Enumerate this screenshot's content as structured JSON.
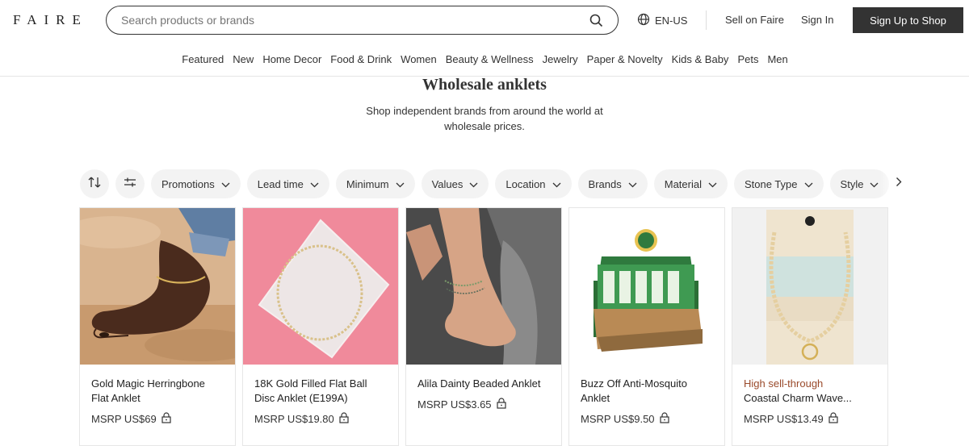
{
  "header": {
    "logo": "FAIRE",
    "search_placeholder": "Search products or brands",
    "locale": "EN-US",
    "sell_link": "Sell on Faire",
    "signin_link": "Sign In",
    "signup_button": "Sign Up to Shop"
  },
  "categories": [
    "Featured",
    "New",
    "Home Decor",
    "Food & Drink",
    "Women",
    "Beauty & Wellness",
    "Jewelry",
    "Paper & Novelty",
    "Kids & Baby",
    "Pets",
    "Men"
  ],
  "page": {
    "title": "Wholesale anklets",
    "subtitle": "Shop independent brands from around the world at wholesale prices."
  },
  "filters": [
    "Promotions",
    "Lead time",
    "Minimum",
    "Values",
    "Location",
    "Brands",
    "Material",
    "Stone Type",
    "Style"
  ],
  "products": [
    {
      "tag": "",
      "name": "Gold Magic Herringbone Flat Anklet",
      "price": "MSRP US$69"
    },
    {
      "tag": "",
      "name": "18K Gold Filled Flat Ball Disc Anklet (E199A)",
      "price": "MSRP US$19.80"
    },
    {
      "tag": "",
      "name": "Alila Dainty Beaded Anklet",
      "price": "MSRP US$3.65"
    },
    {
      "tag": "",
      "name": "Buzz Off Anti-Mosquito Anklet",
      "price": "MSRP US$9.50"
    },
    {
      "tag": "High sell-through",
      "name": "Coastal Charm Wave...",
      "price": "MSRP US$13.49"
    }
  ],
  "icons": {
    "search": "search-icon",
    "globe": "globe-icon",
    "sort": "sort-icon",
    "filter": "filter-sliders-icon",
    "chevron": "chevron-down-icon",
    "next": "chevron-right-icon",
    "lock": "lock-icon"
  },
  "colors": {
    "signup_bg": "#333333",
    "chip_bg": "#f3f3f3",
    "tag": "#9a4a2b"
  }
}
